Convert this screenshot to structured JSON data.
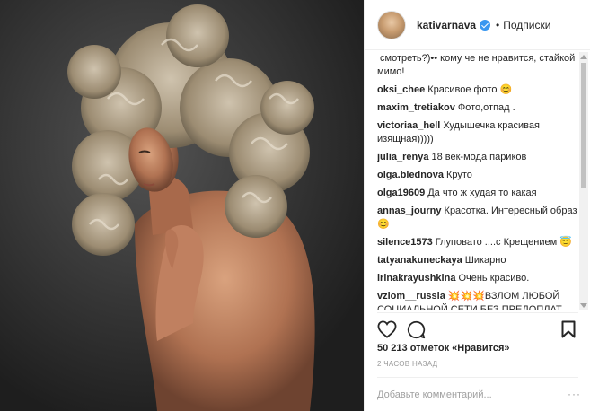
{
  "header": {
    "username": "kativarnava",
    "separator": "•",
    "follow_label": "Подписки"
  },
  "comments": [
    {
      "user": "",
      "text": "смотреть?)•• кому че не нравится, стайкой мимо!"
    },
    {
      "user": "oksi_chee",
      "text": "Красивое фото 😊"
    },
    {
      "user": "maxim_tretiakov",
      "text": "Фото,отпад ."
    },
    {
      "user": "victoriaa_hell",
      "text": "Худышечка красивая изящная)))))"
    },
    {
      "user": "julia_renya",
      "text": "18 век-мода париков"
    },
    {
      "user": "olga.blednova",
      "text": "Круто"
    },
    {
      "user": "olga19609",
      "text": "Да что ж худая то какая"
    },
    {
      "user": "annas_journy",
      "text": "Красотка. Интересный образ😊"
    },
    {
      "user": "silence1573",
      "text": "Глуповато ....с Крещением 😇"
    },
    {
      "user": "tatyanakuneckaya",
      "text": "Шикарно"
    },
    {
      "user": "irinakrayushkina",
      "text": "Очень красиво."
    },
    {
      "user": "vzlom__russia",
      "text": "💥💥💥ВЗЛОМ ЛЮБОЙ СОЦИАЛЬНОЙ СЕТИ БЕЗ ПРЕДОПЛАТ"
    }
  ],
  "icons": {
    "like": "heart-icon",
    "comment": "comment-icon",
    "save": "bookmark-icon",
    "verified": "verified-badge-icon"
  },
  "likes_text": "50 213 отметок «Нравится»",
  "time_text": "2 ЧАСОВ НАЗАД",
  "add_comment": {
    "placeholder": "Добавьте комментарий..."
  },
  "colors": {
    "verified": "#3897f0",
    "divider": "#efefef",
    "muted": "#999999"
  }
}
